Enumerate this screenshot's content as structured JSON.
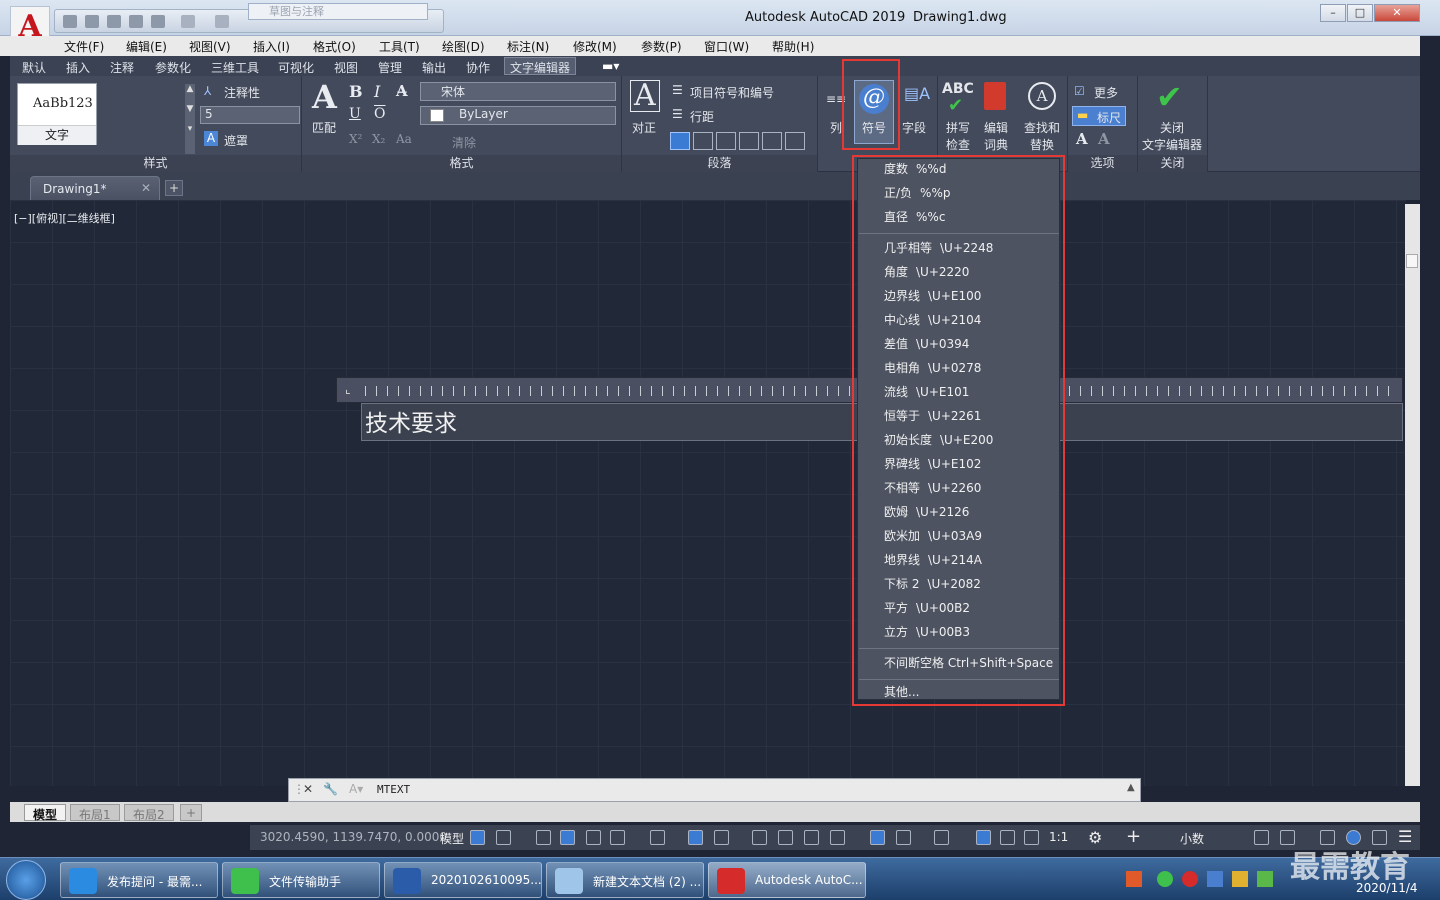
{
  "window": {
    "app_title": "Autodesk AutoCAD 2019",
    "drawing_title": "Drawing1.dwg",
    "workspace": "草图与注释",
    "controls": {
      "minimize": "–",
      "maximize": "□",
      "close": "✕"
    }
  },
  "menu_bar": [
    "文件(F)",
    "编辑(E)",
    "视图(V)",
    "插入(I)",
    "格式(O)",
    "工具(T)",
    "绘图(D)",
    "标注(N)",
    "修改(M)",
    "参数(P)",
    "窗口(W)",
    "帮助(H)"
  ],
  "ribbon_tabs": [
    "默认",
    "插入",
    "注释",
    "参数化",
    "三维工具",
    "可视化",
    "视图",
    "管理",
    "输出",
    "协作",
    "文字编辑器"
  ],
  "ribbon": {
    "style_panel": {
      "title": "样式",
      "preview": "AaBb123",
      "preview_label": "文字",
      "annotative": "注释性",
      "height_value": "5",
      "mask": "遮罩"
    },
    "format_panel": {
      "title": "格式",
      "match": "匹配",
      "font": "宋体",
      "color": "ByLayer",
      "clear": "清除"
    },
    "paragraph_panel": {
      "title": "段落",
      "justify": "对正",
      "bullets": "项目符号和编号",
      "line_spacing": "行距"
    },
    "insert_panel": {
      "columns": "列",
      "symbol": "符号",
      "field": "字段"
    },
    "spell_panel": {
      "spell_1": "拼写",
      "spell_2": "检查",
      "dict_1": "编辑",
      "dict_2": "词典"
    },
    "find_panel": {
      "find_1": "查找和",
      "find_2": "替换"
    },
    "options_panel": {
      "title": "选项",
      "more": "更多",
      "ruler": "标尺"
    },
    "close_panel": {
      "title": "关闭",
      "close_1": "关闭",
      "close_2": "文字编辑器"
    }
  },
  "doc_tab": "Drawing1*",
  "viewport_label": "[−][俯视][二维线框]",
  "mtext_content": "技术要求",
  "symbol_menu": {
    "group1": [
      {
        "name": "度数",
        "code": "%%d"
      },
      {
        "name": "正/负",
        "code": "%%p"
      },
      {
        "name": "直径",
        "code": "%%c"
      }
    ],
    "group2": [
      {
        "name": "几乎相等",
        "code": "\\U+2248"
      },
      {
        "name": "角度",
        "code": "\\U+2220"
      },
      {
        "name": "边界线",
        "code": "\\U+E100"
      },
      {
        "name": "中心线",
        "code": "\\U+2104"
      },
      {
        "name": "差值",
        "code": "\\U+0394"
      },
      {
        "name": "电相角",
        "code": "\\U+0278"
      },
      {
        "name": "流线",
        "code": "\\U+E101"
      },
      {
        "name": "恒等于",
        "code": "\\U+2261"
      },
      {
        "name": "初始长度",
        "code": "\\U+E200"
      },
      {
        "name": "界碑线",
        "code": "\\U+E102"
      },
      {
        "name": "不相等",
        "code": "\\U+2260"
      },
      {
        "name": "欧姆",
        "code": "\\U+2126"
      },
      {
        "name": "欧米加",
        "code": "\\U+03A9"
      },
      {
        "name": "地界线",
        "code": "\\U+214A"
      },
      {
        "name": "下标 2",
        "code": "\\U+2082"
      },
      {
        "name": "平方",
        "code": "\\U+00B2"
      },
      {
        "name": "立方",
        "code": "\\U+00B3"
      }
    ],
    "nbsp": "不间断空格 Ctrl+Shift+Space",
    "other": "其他..."
  },
  "command_line": "MTEXT",
  "layout_tabs": [
    "模型",
    "布局1",
    "布局2"
  ],
  "status": {
    "coords": "3020.4590, 1139.7470, 0.0000",
    "model": "模型",
    "scale": "1:1",
    "units": "小数"
  },
  "taskbar": {
    "items": [
      "发布提问 - 最需...",
      "文件传输助手",
      "2020102610095...",
      "新建文本文档 (2) ...",
      "Autodesk AutoC..."
    ],
    "date": "2020/11/4"
  },
  "watermark": "最需教育",
  "colors": {
    "accent_highlight": "#e53935",
    "ribbon_bg": "#434a5b",
    "canvas_bg": "#212838"
  }
}
